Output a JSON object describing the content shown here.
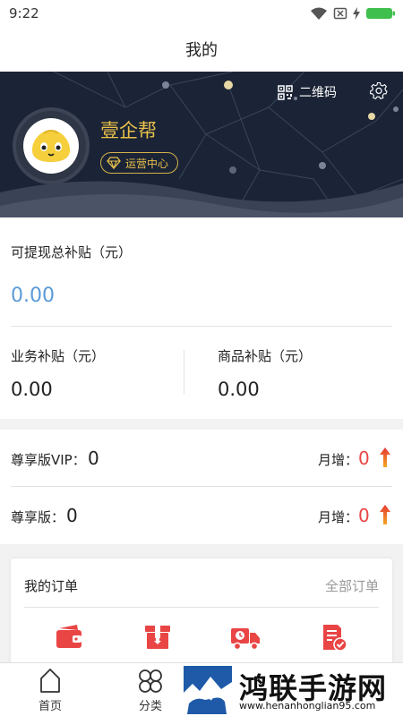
{
  "status_bar": {
    "time": "9:22"
  },
  "header": {
    "title": "我的"
  },
  "profile": {
    "name": "壹企帮",
    "role_badge": "运营中心",
    "qr_label": "二维码"
  },
  "wallet": {
    "total_label": "可提现总补贴（元）",
    "total_value": "0.00",
    "business_label": "业务补贴（元）",
    "business_value": "0.00",
    "goods_label": "商品补贴（元）",
    "goods_value": "0.00"
  },
  "membership": {
    "rows": [
      {
        "label": "尊享版VIP：",
        "count": "0",
        "increase_label": "月增：",
        "increase_value": "0"
      },
      {
        "label": "尊享版：",
        "count": "0",
        "increase_label": "月增：",
        "increase_value": "0"
      }
    ]
  },
  "orders": {
    "title": "我的订单",
    "all_link": "全部订单",
    "icons": [
      "wallet-icon",
      "package-icon",
      "truck-icon",
      "review-icon"
    ]
  },
  "tabbar": {
    "tabs": [
      {
        "label": "首页",
        "icon": "home-icon"
      },
      {
        "label": "分类",
        "icon": "category-icon"
      }
    ]
  },
  "watermark": {
    "name": "鸿联手游网",
    "url": "www.henanhonglian95.com"
  },
  "colors": {
    "accent_gold": "#e8c04b",
    "hero_bg": "#1b2436",
    "total_value": "#5b9bd8",
    "increase_red": "#e94545",
    "order_icon_red": "#e94545"
  }
}
